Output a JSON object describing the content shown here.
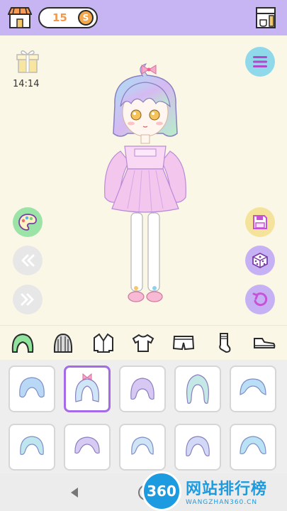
{
  "header": {
    "coins": "15",
    "coin_symbol": "S"
  },
  "stage": {
    "timer": "14:14"
  },
  "categories": [
    "hair",
    "hat",
    "jacket",
    "top",
    "shorts",
    "socks",
    "shoes"
  ],
  "watermark": {
    "logo": "360",
    "title": "网站排行榜",
    "subtitle": "WANGZHAN360.CN"
  },
  "colors": {
    "topbar": "#c7b4f2",
    "stage_bg": "#fbf7e6",
    "selected_tile": "#a46be6",
    "hair_pastel": "#b9d8f5",
    "dress_pink": "#f3c6ee"
  }
}
